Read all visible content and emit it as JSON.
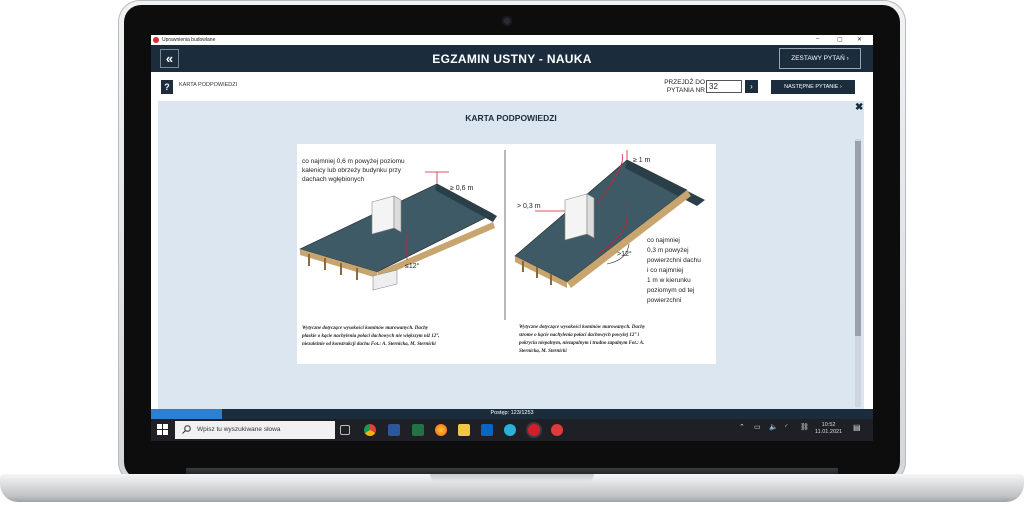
{
  "window": {
    "title": "Uprawnienia budowlane",
    "controls": [
      "–",
      "▢",
      "✕"
    ]
  },
  "header": {
    "back_label": "«",
    "title": "EGZAMIN USTNY - NAUKA",
    "sets_label": "ZESTAWY PYTAŃ  ›"
  },
  "toolbar": {
    "help_label": "?",
    "help_text": "KARTA PODPOWIEDZI",
    "goto_label": "PRZEJDŹ DO PYTANIA NR",
    "goto_value": "32",
    "goto_button": "›",
    "next_label": "NASTĘPNE PYTANIE  ›"
  },
  "card": {
    "title": "KARTA PODPOWIEDZI",
    "close": "✖",
    "left": {
      "annotation": [
        "co najmniej 0,6 m powyżej poziomu",
        "kalenicy lub obrzeży budynku przy",
        "dachach wgłębionych"
      ],
      "label_height": "≥ 0,6 m",
      "label_angle": "≤12°",
      "caption": [
        "Wytyczne dotyczące wysokości kominów murowanych. Dachy",
        "płaskie o kącie nachylenia połaci dachowych nie większym niż 12°,",
        "niezależnie od konstrukcji dachu Fot.: A. Sternicka, M. Sternicki"
      ]
    },
    "right": {
      "label_top": "≥ 1 m",
      "label_side": "> 0,3 m",
      "label_angle": ">12°",
      "annotation": [
        "co najmniej",
        "0,3 m powyżej",
        "powierzchni dachu",
        "i co najmniej",
        "1 m w kierunku",
        "poziomym od tej",
        "powierzchni"
      ],
      "caption": [
        "Wytyczne dotyczące wysokości kominów murowanych. Dachy",
        "strome o kącie nachylenia połaci dachowych powyżej 12° i",
        "pokryciu niepalnym, niezapalnym i trudno zapalnym Fot.: A.",
        "Sternicka, M. Sternicki"
      ]
    }
  },
  "progress": {
    "text": "Postęp: 123/1253",
    "fraction": 0.098
  },
  "taskbar": {
    "search_placeholder": "Wpisz tu wyszukiwane słowa",
    "time": "10:52",
    "date": "11.01.2021",
    "apps": [
      "task-view-icon",
      "chrome-icon",
      "word-icon",
      "excel-icon",
      "firefox-icon",
      "file-explorer-icon",
      "outlook-icon",
      "edge-icon",
      "app-icon",
      "app2-icon"
    ]
  },
  "colors": {
    "navy": "#1b2d3d",
    "panel": "#dce6f1",
    "progress": "#2f7fd1",
    "roof": "#3d5a66",
    "red": "#d21f2d"
  }
}
